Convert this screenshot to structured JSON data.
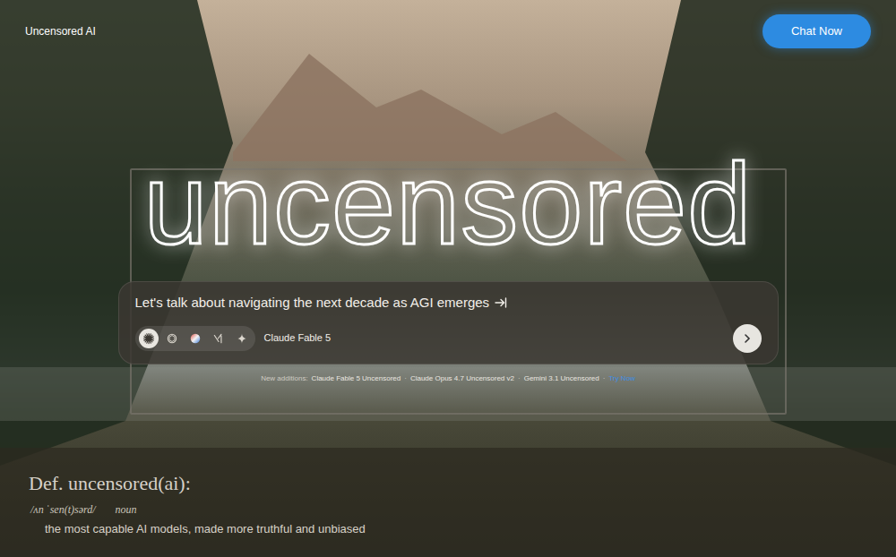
{
  "header": {
    "brand": "Uncensored AI",
    "chat_button": "Chat Now"
  },
  "hero": {
    "title": "uncensored"
  },
  "prompt": {
    "text": "Let's talk about navigating the next decade as AGI emerges",
    "models": [
      {
        "kind": "claude",
        "selected": true
      },
      {
        "kind": "openai",
        "selected": false
      },
      {
        "kind": "orb",
        "selected": false
      },
      {
        "kind": "xai",
        "selected": false
      },
      {
        "kind": "gemini",
        "selected": false
      }
    ],
    "model_label": "Claude Fable 5"
  },
  "new_additions": {
    "label": "New additions:",
    "items": [
      "Claude Fable 5 Uncensored",
      "Claude Opus 4.7 Uncensored v2",
      "Gemini 3.1 Uncensored"
    ],
    "separator": "·",
    "link": "Try Now"
  },
  "definition": {
    "term": "Def. uncensored(ai):",
    "pronunciation": "/ʌn ˈsen(t)sərd/",
    "part_of_speech": "noun",
    "meaning": "the most capable AI models, made more truthful and unbiased"
  }
}
